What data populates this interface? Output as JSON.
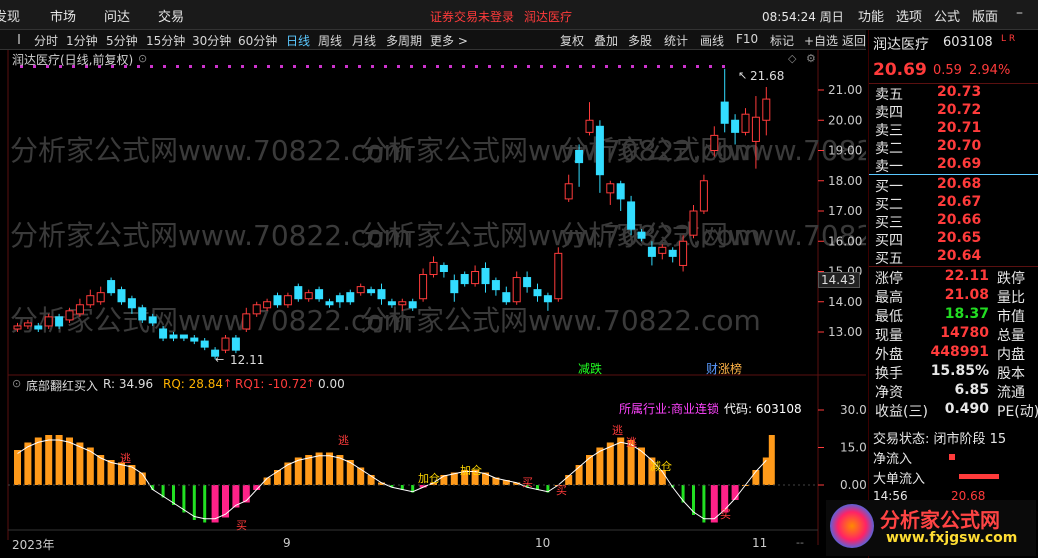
{
  "menubar": {
    "items": [
      "发现",
      "市场",
      "问达",
      "交易"
    ],
    "warning": "证券交易未登录",
    "stock_link": "润达医疗",
    "clock": "08:54:24 周日",
    "right_items": [
      "功能",
      "选项",
      "公式",
      "版面"
    ]
  },
  "periods": [
    "分时",
    "1分钟",
    "5分钟",
    "15分钟",
    "30分钟",
    "60分钟",
    "日线",
    "周线",
    "月线",
    "多周期",
    "更多 >"
  ],
  "active_period": "日线",
  "toolbar": [
    "复权",
    "叠加",
    "多股",
    "统计",
    "画线",
    "F10",
    "标记",
    "+自选",
    "返回"
  ],
  "chart": {
    "title": "润达医疗(日线,前复权)",
    "high_label": "21.68",
    "low_label": "12.11",
    "crosshair_price": "14.43",
    "price_axis": [
      "21.00",
      "20.00",
      "19.00",
      "18.00",
      "17.00",
      "16.00",
      "15.00",
      "14.00",
      "13.00"
    ],
    "tags": [
      "减跌",
      "财",
      "涨榜"
    ],
    "watermark": "分析家公式网www.70822.com"
  },
  "indicator": {
    "name": "底部翻红买入",
    "r_label": "R: 34.96",
    "rq_label": "RQ: 28.84",
    "rq1_label": "RQ1: -10.72",
    "extra": "0.00",
    "industry": "所属行业:商业连锁",
    "code_label": "代码: 603108",
    "axis": [
      "30.00",
      "15.00",
      "0.00"
    ],
    "signals": [
      "逃",
      "逃",
      "买",
      "加仓",
      "加仓",
      "逃",
      "买",
      "减仓",
      "逃",
      "买",
      "买"
    ],
    "x_axis": [
      "2023年",
      "9",
      "10",
      "11"
    ]
  },
  "quote": {
    "name": "润达医疗",
    "code": "603108",
    "price": "20.69",
    "change": "0.59",
    "pct": "2.94%",
    "sell": [
      [
        "卖五",
        "20.73"
      ],
      [
        "卖四",
        "20.72"
      ],
      [
        "卖三",
        "20.71"
      ],
      [
        "卖二",
        "20.70"
      ],
      [
        "卖一",
        "20.69"
      ]
    ],
    "buy": [
      [
        "买一",
        "20.68"
      ],
      [
        "买二",
        "20.67"
      ],
      [
        "买三",
        "20.66"
      ],
      [
        "买四",
        "20.65"
      ],
      [
        "买五",
        "20.64"
      ]
    ],
    "stats": [
      [
        "涨停",
        "22.11",
        "跌停"
      ],
      [
        "最高",
        "21.08",
        "量比"
      ],
      [
        "最低",
        "18.37",
        "市值"
      ],
      [
        "现量",
        "14780",
        "总量"
      ],
      [
        "外盘",
        "448991",
        "内盘"
      ],
      [
        "换手",
        "15.85%",
        "股本"
      ],
      [
        "净资",
        "6.85",
        "流通"
      ],
      [
        "收益(三)",
        "0.490",
        "PE(动)"
      ]
    ],
    "trade_status": "交易状态: 闭市阶段 15",
    "netflow": "净流入",
    "bigflow": "大单流入",
    "last_time": "14:56",
    "last_price": "20.68"
  },
  "logo": {
    "title": "分析家公式网",
    "url": "www.fxjgsw.com"
  },
  "colors": {
    "up": "#ff3b3b",
    "down": "#33ddff",
    "vol_up": "#ff9a1a",
    "vol_down": "#22e022",
    "pink": "#ff2288",
    "dot": "#cc33cc"
  }
}
